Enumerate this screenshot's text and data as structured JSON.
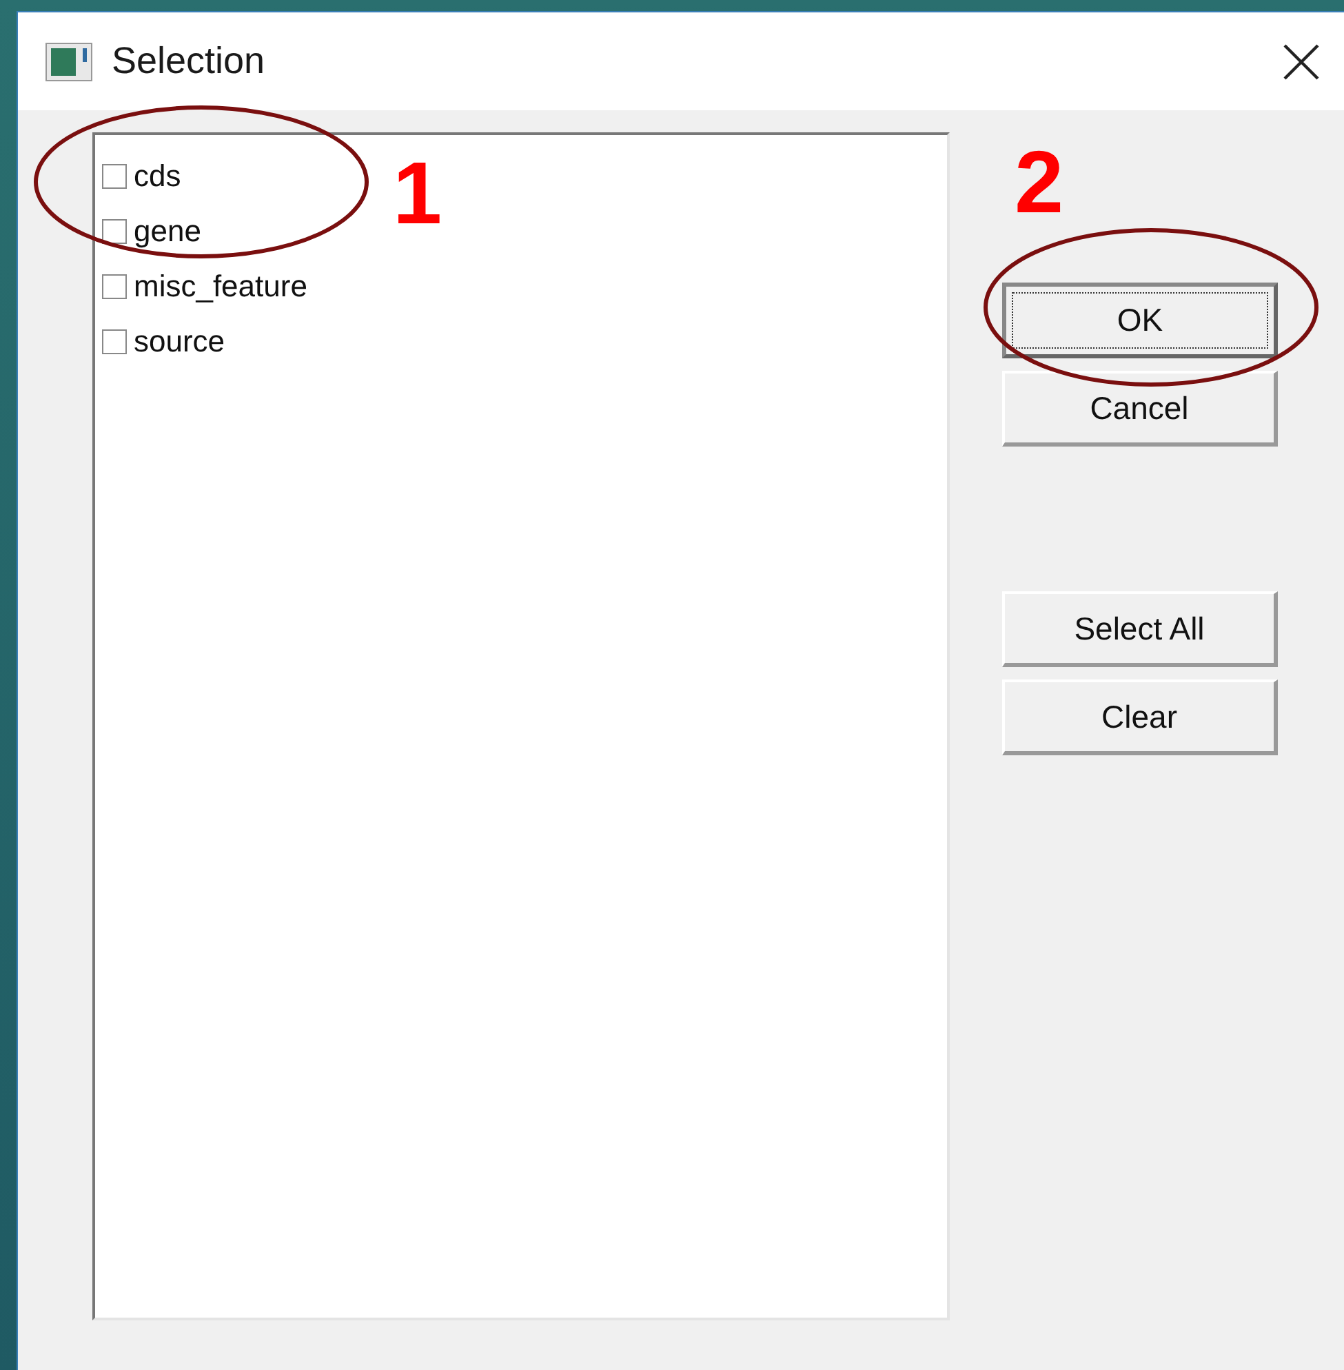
{
  "window": {
    "title": "Selection"
  },
  "items": [
    {
      "label": "cds",
      "checked": false
    },
    {
      "label": "gene",
      "checked": false
    },
    {
      "label": "misc_feature",
      "checked": false
    },
    {
      "label": "source",
      "checked": false
    }
  ],
  "buttons": [
    {
      "label": "OK",
      "default": true
    },
    {
      "label": "Cancel",
      "default": false
    },
    {
      "label": "Select All",
      "default": false
    },
    {
      "label": "Clear",
      "default": false
    }
  ],
  "annotations": [
    {
      "number": "1"
    },
    {
      "number": "2"
    }
  ]
}
